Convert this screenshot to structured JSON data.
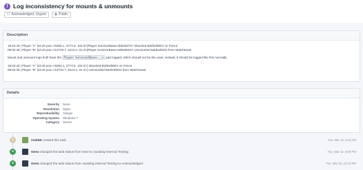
{
  "task": {
    "status_icon": "!",
    "title": "Log inconsistency for mounts & unmounts",
    "tags": [
      {
        "icon": "checkbox-icon",
        "label": "Acknowledged, Urgent"
      },
      {
        "icon": "globe-icon",
        "label": "Public"
      }
    ]
  },
  "description": {
    "heading": "Description",
    "block1": {
      "line1": "18:42:43 | Player \"A\" (id=ID pos=<5363.1, 2774.5, 102.6>)Player SurvivorBase<4b632670> Mounted BarbedWire on Fence",
      "line2": "09:02:48 | Player \"B\" (id=ID pos=<12733.7, 8113.4, 31.3>)Player SurvivorBase<4d0e8010> Unmounted BarbedWire from Watchtower"
    },
    "sentence": {
      "before": "Mount and unmount logs both have the ",
      "code": "Player SurvivorBase<...>",
      "after": " part logged, which should not be the case; instead, it should be logged like this normally:"
    },
    "block2": {
      "line1": "18:42:43 | Player \"A\" (id=ID pos=<5363.1, 2774.5, 102.6>) Mounted BarbedWire on Fence",
      "line2": "09:02:48 | Player \"B\" (id=ID pos=<12733.7, 8113.4, 31.3>) Unmounted BarbedWire from Watchtower"
    }
  },
  "details": {
    "heading": "Details",
    "rows": [
      {
        "key": "Severity",
        "value": "None"
      },
      {
        "key": "Resolution",
        "value": "Open"
      },
      {
        "key": "Reproducibility",
        "value": "Always"
      },
      {
        "key": "Operating System",
        "value": "Windows 7"
      },
      {
        "key": "Category",
        "value": "Server"
      }
    ]
  },
  "timeline": [
    {
      "icon": "pencil-icon",
      "icon_color": "#d9c9a6",
      "avatar_color": "#7aa35a",
      "user": "rock69",
      "text": " created this task.",
      "date": "Tue, Mar 12, 5:42 AM"
    },
    {
      "icon": "dot-icon",
      "icon_color": "#3f9d56",
      "avatar_color": "#2f3b4c",
      "user": "Geez",
      "pre": " changed the task status from ",
      "from": "New",
      "mid": " to ",
      "to": "Awaiting Internal Testing",
      "post": ".",
      "date": "Tue, Mar 12, 9:08 PM"
    },
    {
      "icon": "dot-icon",
      "icon_color": "#3f9d56",
      "avatar_color": "#2f3b4c",
      "user": "Geez",
      "pre": " changed the task status from ",
      "from": "Awaiting Internal Testing",
      "mid": " to ",
      "to": "Acknowledged",
      "post": ".",
      "date": "Tue, Mar 26, 10:13 PM"
    }
  ]
}
